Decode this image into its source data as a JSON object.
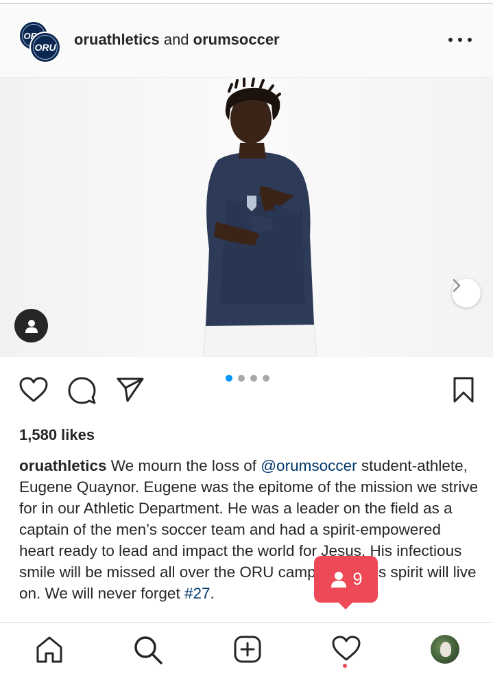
{
  "header": {
    "account1": "oruathletics",
    "connector": "and",
    "account2": "orumsoccer",
    "avatar_text": "ORU",
    "more_icon": "more-horizontal-icon"
  },
  "post": {
    "image_alt": "Soccer player in navy ORU jersey pointing",
    "carousel": {
      "current": 1,
      "total": 4
    },
    "likes": "1,580 likes",
    "caption": {
      "username": "oruathletics",
      "text_before": " We mourn the loss of ",
      "mention": "@orumsoccer",
      "text_after": " student-athlete, Eugene Quaynor. Eugene was the epitome of the mission we strive for in our Athletic Department. He was a leader on the field as a captain of the men’s soccer team and had a spirit-empowered heart ready to lead and impact the world for Jesus. His infectious smile will be missed all over the ORU campus, but his spirit will live on. We will never forget ",
      "hashtag": "#27",
      "end": "."
    }
  },
  "activity_badge": {
    "count": "9",
    "icon": "person-icon"
  },
  "nav": {
    "items": [
      "home-icon",
      "search-icon",
      "new-post-icon",
      "activity-heart-icon",
      "profile-avatar"
    ]
  },
  "colors": {
    "link": "#00376b",
    "accent": "#0095f6",
    "badge": "#ed4956"
  }
}
